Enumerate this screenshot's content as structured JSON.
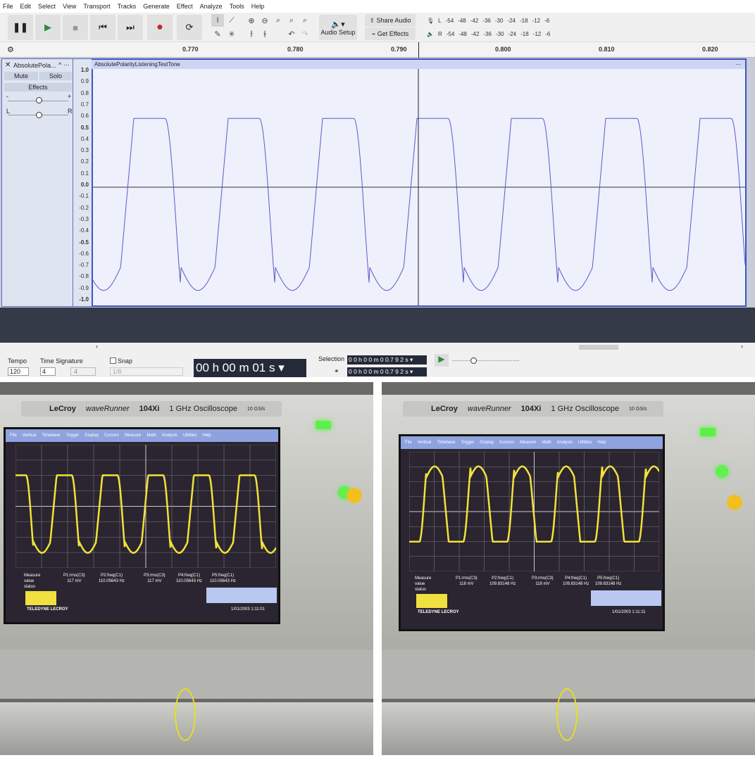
{
  "menu": [
    "File",
    "Edit",
    "Select",
    "View",
    "Transport",
    "Tracks",
    "Generate",
    "Effect",
    "Analyze",
    "Tools",
    "Help"
  ],
  "toolbar": {
    "audio_setup": "Audio Setup",
    "share_audio": "Share Audio",
    "get_effects": "Get Effects",
    "meter_ticks": [
      "-54",
      "-48",
      "-42",
      "-36",
      "-30",
      "-24",
      "-18",
      "-12",
      "-6"
    ],
    "meter_l": "L",
    "meter_r": "R"
  },
  "ruler": {
    "labels": [
      "0.770",
      "0.780",
      "0.790",
      "0.800",
      "0.810",
      "0.820"
    ]
  },
  "track": {
    "name": "AbsolutePola...",
    "clip_name": "AbsolutePolarityListeningTestTone",
    "mute": "Mute",
    "solo": "Solo",
    "effects": "Effects",
    "gain_minus": "-",
    "gain_plus": "+",
    "pan_l": "L",
    "pan_r": "R",
    "scale": [
      "1.0",
      "0.9",
      "0.8",
      "0.7",
      "0.6",
      "0.5",
      "0.4",
      "0.3",
      "0.2",
      "0.1",
      "0.0",
      "-0.1",
      "-0.2",
      "-0.3",
      "-0.4",
      "-0.5",
      "-0.6",
      "-0.7",
      "-0.8",
      "-0.9",
      "-1.0"
    ]
  },
  "bottom": {
    "tempo_label": "Tempo",
    "tempo": "120",
    "timesig_label": "Time Signature",
    "timesig_num": "4",
    "timesig_den": "4",
    "snap_label": "Snap",
    "snap_value": "1/8",
    "time": "00 h 00 m 01 s",
    "selection_label": "Selection",
    "sel_start": "0 0 h 0 0 m 0 0.7 9 2 s",
    "sel_end": "0 0 h 0 0 m 0 0.7 9 2 s"
  },
  "scope_left": {
    "brand": "LeCroy",
    "model_name": "waveRunner",
    "model": "104Xi",
    "desc": "1 GHz Oscilloscope",
    "rate": "10 GS/s",
    "menu": [
      "File",
      "Vertical",
      "Timebase",
      "Trigger",
      "Display",
      "Cursors",
      "Measure",
      "Math",
      "Analysis",
      "Utilities",
      "Help"
    ],
    "measure_labels": [
      "Measure",
      "value",
      "status"
    ],
    "params": [
      {
        "name": "P1:rms(C3)",
        "value": "117 mV"
      },
      {
        "name": "P2:freq(C1)",
        "value": "110.05643 Hz"
      },
      {
        "name": "P3:rms(C3)",
        "value": "117 mV"
      },
      {
        "name": "P4:freq(C1)",
        "value": "110.05643 Hz"
      },
      {
        "name": "P5:freq(C1)",
        "value": "110.05643 Hz"
      }
    ],
    "footer": "TELEDYNE LECROY",
    "datetime": "1/01/2003 1:11:01"
  },
  "scope_right": {
    "brand": "LeCroy",
    "model_name": "waveRunner",
    "model": "104Xi",
    "desc": "1 GHz Oscilloscope",
    "rate": "10 GS/s",
    "menu": [
      "File",
      "Vertical",
      "Timebase",
      "Trigger",
      "Display",
      "Cursors",
      "Measure",
      "Math",
      "Analysis",
      "Utilities",
      "Help"
    ],
    "measure_labels": [
      "Measure",
      "value",
      "status"
    ],
    "params": [
      {
        "name": "P1:rms(C3)",
        "value": "118 mV"
      },
      {
        "name": "P2:freq(C1)",
        "value": "109.83148 Hz"
      },
      {
        "name": "P3:rms(C3)",
        "value": "118 mV"
      },
      {
        "name": "P4:freq(C1)",
        "value": "109.83148 Hz"
      },
      {
        "name": "P5:freq(C1)",
        "value": "109.83148 Hz"
      }
    ],
    "footer": "TELEDYNE LECROY",
    "datetime": "1/01/2003 1:11:11"
  },
  "colors": {
    "waveform": "#5a5ac8",
    "track_border": "#3f55c0",
    "scope_trace": "#f2e23a"
  }
}
